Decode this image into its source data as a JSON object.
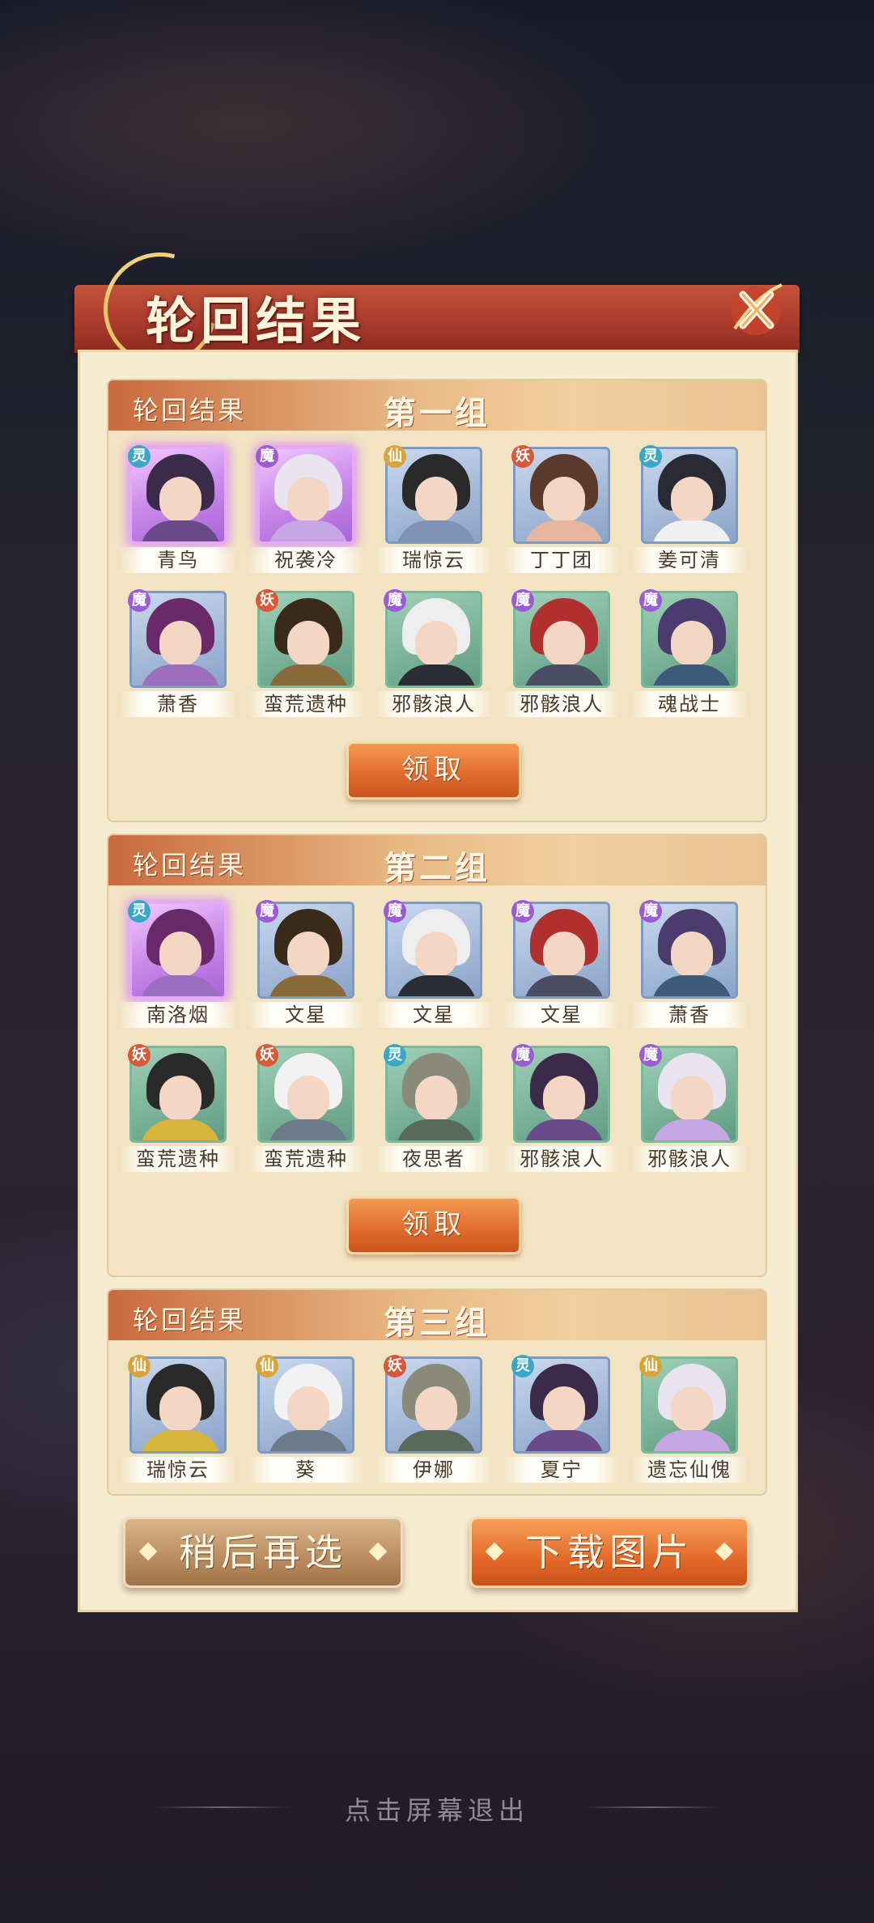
{
  "header": {
    "title": "轮回结果",
    "close_icon": "close-x-icon"
  },
  "groups": [
    {
      "sub": "轮回结果",
      "name": "第一组",
      "claim": "领取",
      "heroes": [
        {
          "name": "青鸟",
          "faction": "灵",
          "rarity": "purple"
        },
        {
          "name": "祝袭冷",
          "faction": "魔",
          "rarity": "purple"
        },
        {
          "name": "瑞惊云",
          "faction": "仙",
          "rarity": "blue"
        },
        {
          "name": "丁丁团",
          "faction": "妖",
          "rarity": "blue"
        },
        {
          "name": "姜可清",
          "faction": "灵",
          "rarity": "blue"
        },
        {
          "name": "萧香",
          "faction": "魔",
          "rarity": "blue"
        },
        {
          "name": "蛮荒遗种",
          "faction": "妖",
          "rarity": "green"
        },
        {
          "name": "邪骸浪人",
          "faction": "魔",
          "rarity": "green"
        },
        {
          "name": "邪骸浪人",
          "faction": "魔",
          "rarity": "green"
        },
        {
          "name": "魂战士",
          "faction": "魔",
          "rarity": "green"
        }
      ]
    },
    {
      "sub": "轮回结果",
      "name": "第二组",
      "claim": "领取",
      "heroes": [
        {
          "name": "南洛烟",
          "faction": "灵",
          "rarity": "purple"
        },
        {
          "name": "文星",
          "faction": "魔",
          "rarity": "blue"
        },
        {
          "name": "文星",
          "faction": "魔",
          "rarity": "blue"
        },
        {
          "name": "文星",
          "faction": "魔",
          "rarity": "blue"
        },
        {
          "name": "萧香",
          "faction": "魔",
          "rarity": "blue"
        },
        {
          "name": "蛮荒遗种",
          "faction": "妖",
          "rarity": "green"
        },
        {
          "name": "蛮荒遗种",
          "faction": "妖",
          "rarity": "green"
        },
        {
          "name": "夜思者",
          "faction": "灵",
          "rarity": "green"
        },
        {
          "name": "邪骸浪人",
          "faction": "魔",
          "rarity": "green"
        },
        {
          "name": "邪骸浪人",
          "faction": "魔",
          "rarity": "green"
        }
      ]
    },
    {
      "sub": "轮回结果",
      "name": "第三组",
      "heroes": [
        {
          "name": "瑞惊云",
          "faction": "仙",
          "rarity": "blue"
        },
        {
          "name": "葵",
          "faction": "仙",
          "rarity": "blue"
        },
        {
          "name": "伊娜",
          "faction": "妖",
          "rarity": "blue"
        },
        {
          "name": "夏宁",
          "faction": "灵",
          "rarity": "blue"
        },
        {
          "name": "遗忘仙傀",
          "faction": "仙",
          "rarity": "green"
        }
      ]
    }
  ],
  "buttons": {
    "later": "稍后再选",
    "download": "下载图片"
  },
  "footer": {
    "hint": "点击屏幕退出"
  },
  "colors": {
    "header_red": "#a9392a",
    "panel_bg": "#f6ecd2",
    "accent_orange": "#e06a2c",
    "purple_glow": "#d278ff"
  }
}
